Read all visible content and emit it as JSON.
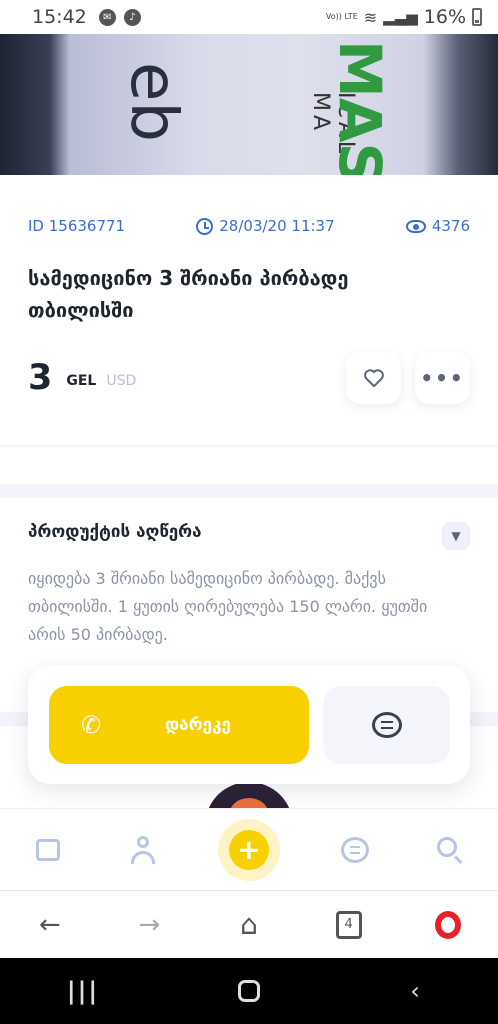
{
  "statusbar": {
    "time": "15:42",
    "battery": "16%",
    "volte": "Vo)) LTE"
  },
  "listing": {
    "id_text": "ID 15636771",
    "date": "28/03/20 11:37",
    "views": "4376",
    "title": "სამედიცინო 3 შრიანი პირბადე თბილისში",
    "price": "3",
    "currency_primary": "GEL",
    "currency_secondary": "USD",
    "carousel": {
      "total": 3,
      "active_index": 2
    }
  },
  "description": {
    "heading": "პროდუქტის აღწერა",
    "text": "იყიდება 3 შრიანი სამედიცინო პირბადე. მაქვს თბილისში. 1 ყუთის ღირებულება 150 ლარი. ყუთში არის 50 პირბადე."
  },
  "cta": {
    "call_label": "დარეკე"
  },
  "hero": {
    "brand_text": "eb",
    "green_text": "MAS",
    "sub_text": "ICAL MA"
  },
  "browser": {
    "tab_count": "4"
  },
  "colors": {
    "accent_yellow": "#f8d000",
    "link_blue": "#3a6fd0",
    "nav_icon": "#b7c7e3",
    "opera_red": "#e8202a"
  }
}
